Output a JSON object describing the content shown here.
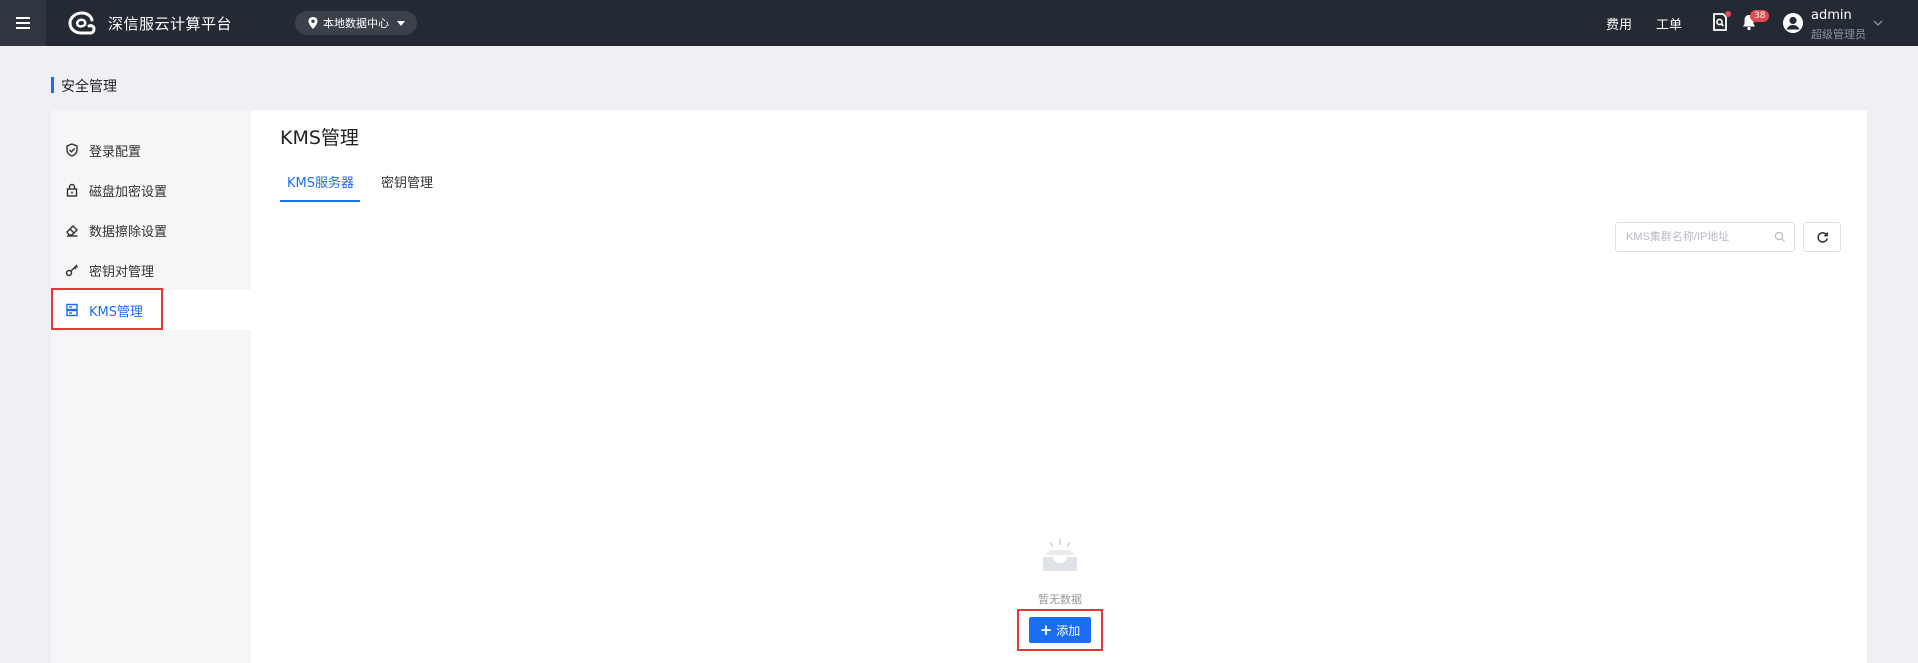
{
  "topbar": {
    "brand": "深信服云计算平台",
    "region": "本地数据中心",
    "links": [
      "费用",
      "工单"
    ],
    "notification_count": "38",
    "user_name": "admin",
    "user_role": "超级管理员"
  },
  "page_title": "安全管理",
  "sidebar": {
    "items": [
      {
        "label": "登录配置",
        "icon": "shield-check-icon"
      },
      {
        "label": "磁盘加密设置",
        "icon": "lock-icon"
      },
      {
        "label": "数据擦除设置",
        "icon": "eraser-icon"
      },
      {
        "label": "密钥对管理",
        "icon": "key-icon"
      },
      {
        "label": "KMS管理",
        "icon": "server-icon"
      }
    ],
    "active_index": 4
  },
  "main": {
    "title": "KMS管理",
    "tabs": [
      "KMS服务器",
      "密钥管理"
    ],
    "active_tab": 0,
    "search_placeholder": "KMS集群名称/IP地址",
    "empty_text": "暂无数据",
    "add_label": "添加"
  },
  "colors": {
    "topbar": "#242a33",
    "accent": "#1a6ef5",
    "highlight": "#e53935"
  }
}
